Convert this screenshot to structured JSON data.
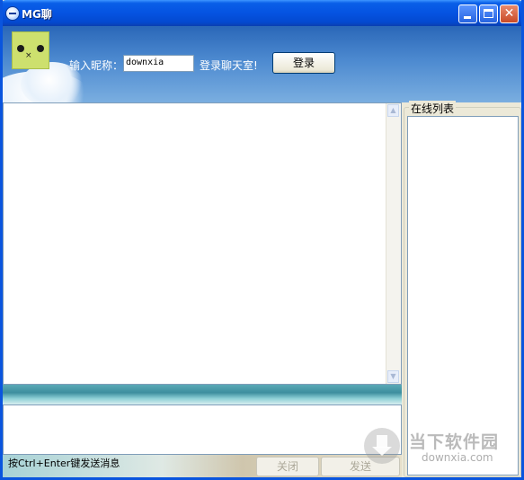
{
  "window": {
    "title": "MG聊"
  },
  "header": {
    "nick_label": "输入昵称：",
    "nick_value": "downxia",
    "login_prompt": "登录聊天室!",
    "login_button": "登录"
  },
  "footer": {
    "hint": "按Ctrl+Enter键发送消息",
    "close_button": "关闭",
    "send_button": "发送"
  },
  "online": {
    "title": "在线列表"
  },
  "watermark": {
    "brand": "当下软件园",
    "url": "downxia.com"
  }
}
